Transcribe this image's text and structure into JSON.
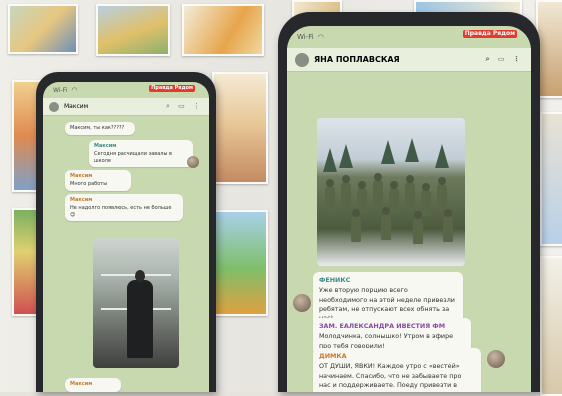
{
  "left_phone": {
    "status_carrier": "Wi-Fi",
    "brand_logo": "Правда Рядом",
    "chat_title": "Максим",
    "messages": [
      {
        "sender": "",
        "text": "Максим, ты как?????"
      },
      {
        "sender": "Максим",
        "text": "Сегодня расчищали завалы в школе"
      },
      {
        "sender": "Максим",
        "text": "Много работы"
      },
      {
        "sender": "Максим",
        "text": "Не надолго появлюсь, есть не больше 😊"
      },
      {
        "sender": "Максим",
        "text": ""
      }
    ]
  },
  "right_phone": {
    "status_carrier": "Wi-Fi",
    "brand_logo": "Правда Рядом",
    "chat_title": "ЯНА ПОПЛАВСКАЯ",
    "messages": [
      {
        "sender": "ФЕНИКС",
        "text": "Уже вторую порцию всего необходимого на этой неделе привезли ребятам, не отпускают всех обнять за нас!"
      },
      {
        "sender": "ЗАМ. ЕАЛЕКСАНДРА ИВЕСТИЯ ФМ",
        "text": "Молодчинка, солнышко! Утром в эфире про тебя говорили!"
      },
      {
        "sender": "ДИМКА",
        "text": "ОТ ДУШИ, ЯВКИ! Каждое утро с «вестей» начинаем. Спасибо, что не забываете про нас и поддерживаете. Поеду привезти в отделку"
      }
    ]
  },
  "colors": {
    "screen": "#c8d9b0",
    "bubble": "#f7f8f2",
    "phone_frame": "#26282c",
    "logo": "#e23a2c"
  }
}
